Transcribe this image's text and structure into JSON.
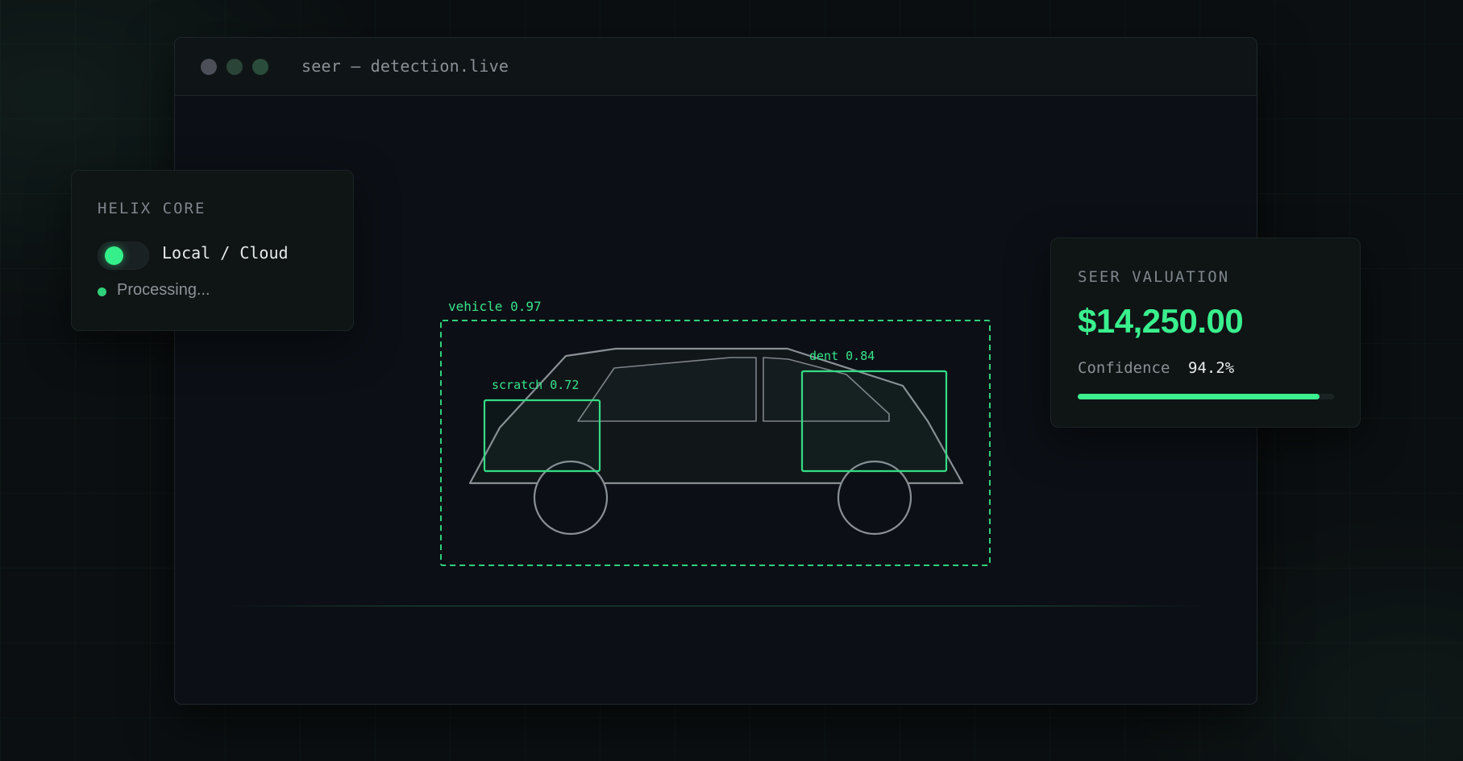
{
  "window": {
    "title": "seer — detection.live"
  },
  "detections": {
    "vehicle": {
      "label": "vehicle 0.97"
    },
    "scratch": {
      "label": "scratch 0.72"
    },
    "dent": {
      "label": "dent 0.84"
    }
  },
  "helix_card": {
    "title": "HELIX CORE",
    "toggle_label": "Local / Cloud",
    "toggle_on": true,
    "status": "Processing..."
  },
  "seer_card": {
    "title": "SEER VALUATION",
    "price": "$14,250.00",
    "confidence_label": "Confidence",
    "confidence_value": "94.2%",
    "confidence_fraction": 0.942
  },
  "colors": {
    "accent": "#39f08d",
    "background": "#0b0f11",
    "panel": "#0f1415",
    "outline": "#8a8f96"
  },
  "icons": {
    "window_controls": [
      "close-dot-icon",
      "minimize-dot-icon",
      "maximize-dot-icon"
    ],
    "status": "status-dot-icon"
  }
}
